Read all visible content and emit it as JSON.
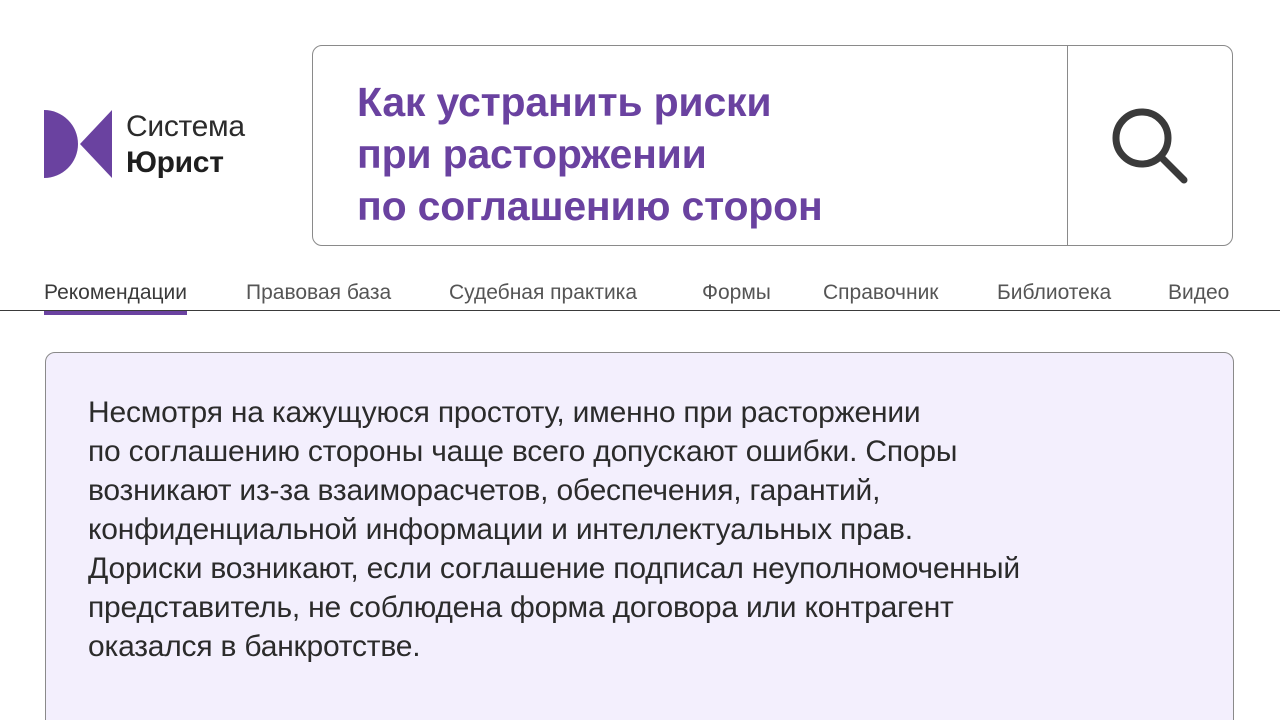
{
  "logo": {
    "line1": "Система",
    "line2": "Юрист"
  },
  "search": {
    "query_lines": [
      "Как устранить риски",
      "при расторжении",
      "по соглашению сторон"
    ],
    "icon": "search-icon"
  },
  "tabs": [
    {
      "label": "Рекомендации",
      "active": true
    },
    {
      "label": "Правовая база",
      "active": false
    },
    {
      "label": "Судебная практика",
      "active": false
    },
    {
      "label": "Формы",
      "active": false
    },
    {
      "label": "Справочник",
      "active": false
    },
    {
      "label": "Библиотека",
      "active": false
    },
    {
      "label": "Видео",
      "active": false
    }
  ],
  "content": {
    "lines": [
      "Несмотря на кажущуюся простоту, именно при расторжении",
      "по соглашению стороны чаще всего допускают ошибки. Споры",
      "возникают из-за взаиморасчетов, обеспечения, гарантий,",
      "конфиденциальной информации и интеллектуальных прав.",
      "Дориски возникают, если соглашение подписал неуполномоченный",
      "представитель, не соблюдена форма договора или контрагент",
      "оказался в банкротстве."
    ]
  },
  "colors": {
    "accent": "#6a42a0",
    "card_bg": "#f3effd",
    "border": "#8a8a8a"
  }
}
